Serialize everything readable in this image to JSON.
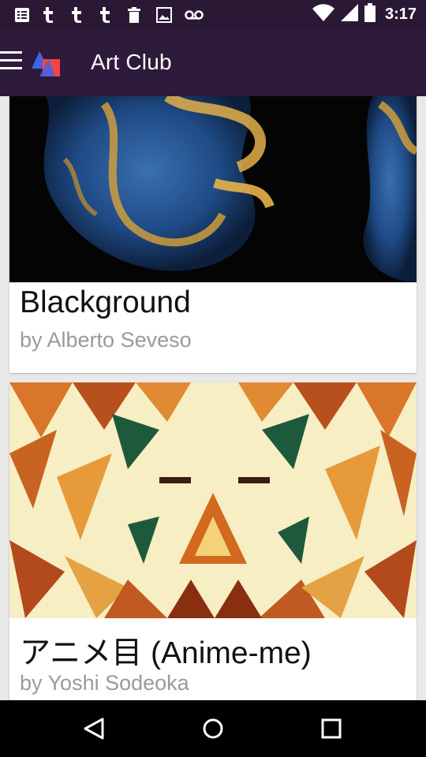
{
  "status_bar": {
    "time": "3:17",
    "notification_icons": [
      "calendar-icon",
      "tumblr-icon",
      "tumblr-icon",
      "tumblr-icon",
      "trash-icon",
      "image-icon",
      "voicemail-icon"
    ],
    "system_icons": [
      "wifi-icon",
      "cell-signal-icon",
      "battery-icon"
    ]
  },
  "app_bar": {
    "title": "Art Club",
    "background": "#2e1a3a"
  },
  "feed": {
    "cards": [
      {
        "title": "Blackground",
        "author": "by Alberto Seveso"
      },
      {
        "title": "アニメ目 (Anime-me)",
        "author": "by Yoshi Sodeoka"
      }
    ]
  },
  "nav_bar": {
    "buttons": [
      "back-icon",
      "home-icon",
      "recents-icon"
    ]
  }
}
